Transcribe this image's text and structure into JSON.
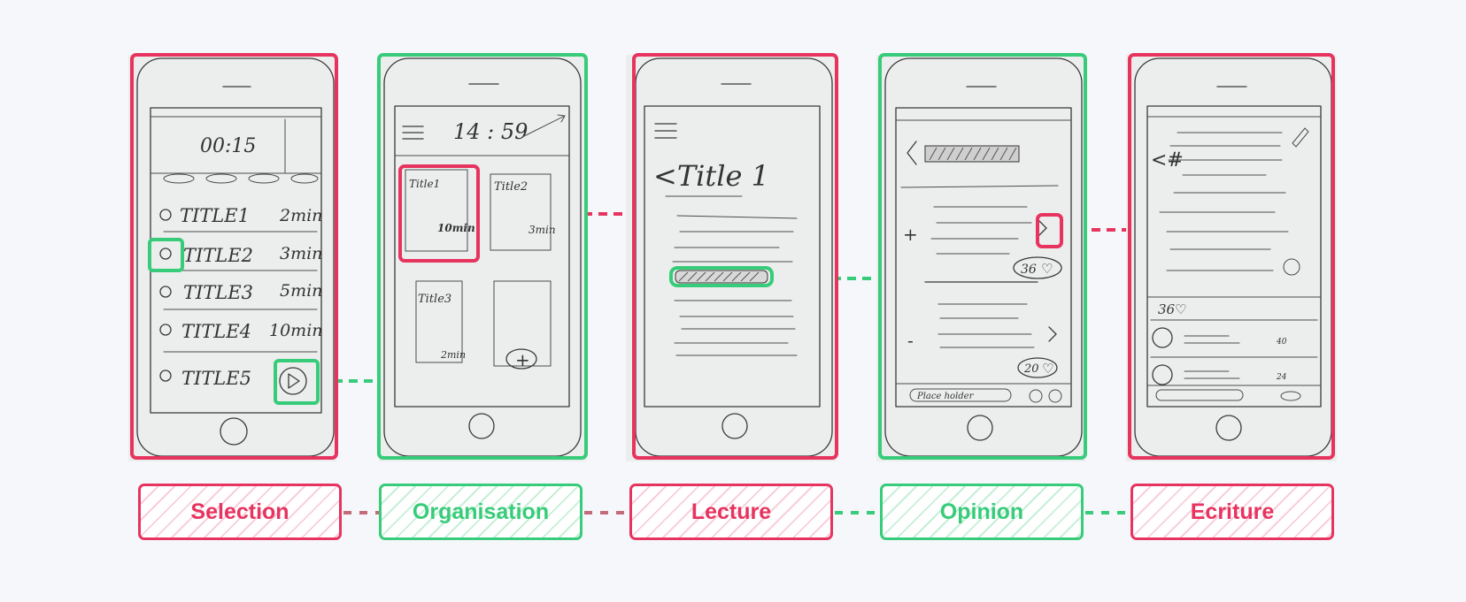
{
  "stages": [
    {
      "id": "selection",
      "label": "Selection",
      "color": "#e7345f"
    },
    {
      "id": "organisation",
      "label": "Organisation",
      "color": "#37cc79"
    },
    {
      "id": "lecture",
      "label": "Lecture",
      "color": "#e7345f"
    },
    {
      "id": "opinion",
      "label": "Opinion",
      "color": "#37cc79"
    },
    {
      "id": "ecriture",
      "label": "Ecriture",
      "color": "#e7345f"
    }
  ],
  "selection": {
    "timer": "00:15",
    "rows": [
      {
        "title": "TITLE1",
        "time": "2min"
      },
      {
        "title": "TITLE2",
        "time": "3min"
      },
      {
        "title": "TITLE3",
        "time": "5min"
      },
      {
        "title": "TITLE4",
        "time": "10min"
      },
      {
        "title": "TITLE5",
        "time": ""
      }
    ]
  },
  "organisation": {
    "clock": "14 : 59",
    "cards": [
      {
        "title": "Title1",
        "time": "10min"
      },
      {
        "title": "Title2",
        "time": "3min"
      },
      {
        "title": "Title3",
        "time": "2min"
      },
      {
        "title": "",
        "time": ""
      }
    ],
    "add_symbol": "+"
  },
  "lecture": {
    "heading": "<Title 1"
  },
  "opinion": {
    "likes_1": "36",
    "likes_2": "20",
    "plus_symbol": "+",
    "minus_symbol": "-",
    "placeholder": "Place holder"
  },
  "ecriture": {
    "likes": "36",
    "comment_likes_1": "40",
    "comment_likes_2": "24"
  },
  "colors": {
    "red": "#e7345f",
    "green": "#37cc79",
    "background": "#f5f7fb"
  }
}
